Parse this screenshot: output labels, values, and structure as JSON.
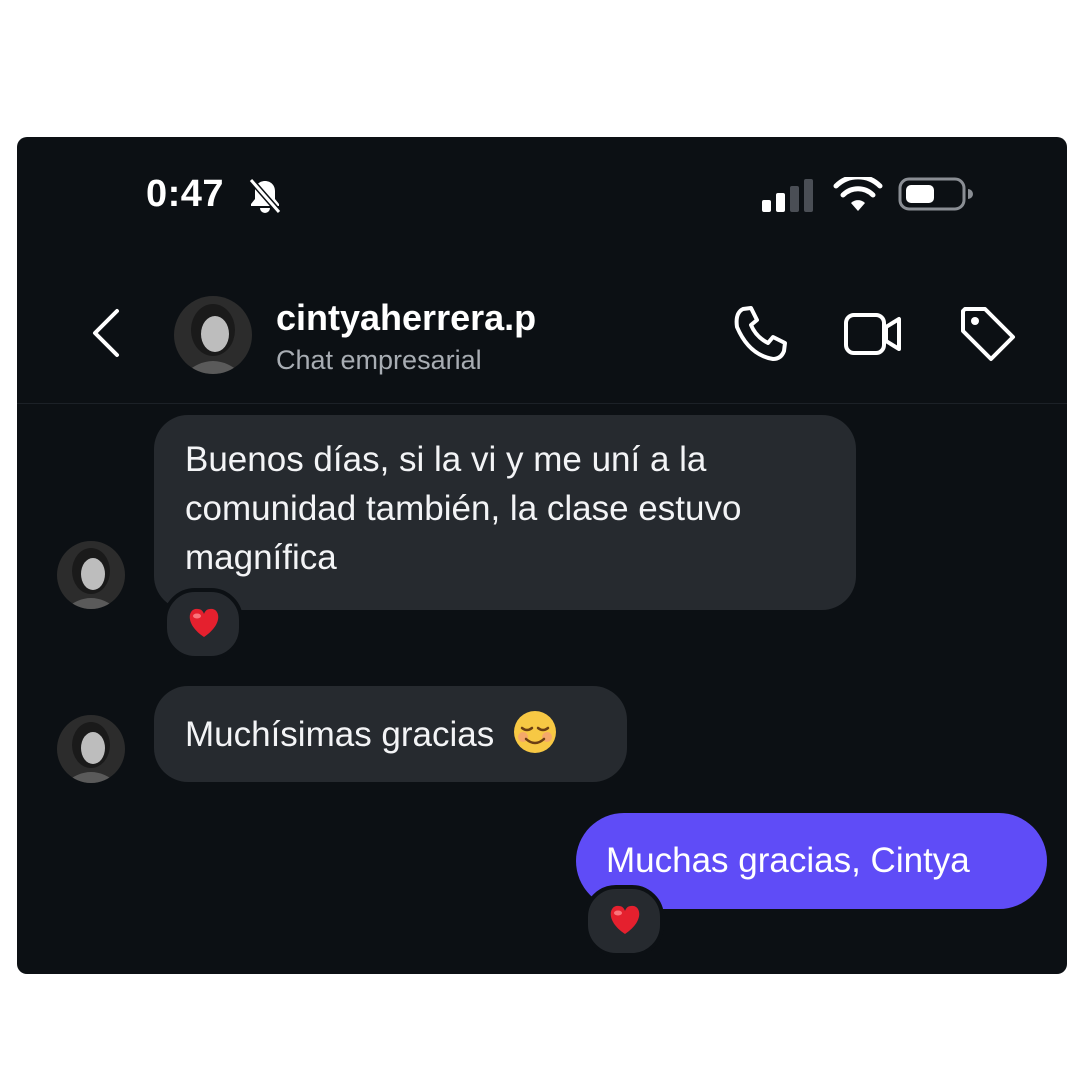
{
  "status_bar": {
    "time": "0:47"
  },
  "header": {
    "username": "cintyaherrera.p",
    "subtitle": "Chat empresarial"
  },
  "messages": [
    {
      "sender": "contact",
      "text": "Buenos días, si la vi y me uní a la comunidad también, la clase estuvo magnífica",
      "reaction": "red-heart"
    },
    {
      "sender": "contact",
      "text": "Muchísimas gracias",
      "emoji": "smiling-face-emoji"
    },
    {
      "sender": "me",
      "text": "Muchas gracias, Cintya",
      "reaction": "red-heart"
    }
  ],
  "colors": {
    "background": "#0c1014",
    "incoming_bubble": "#262a2f",
    "outgoing_bubble": "#5f4cf7",
    "subtitle": "#a8adb3"
  }
}
